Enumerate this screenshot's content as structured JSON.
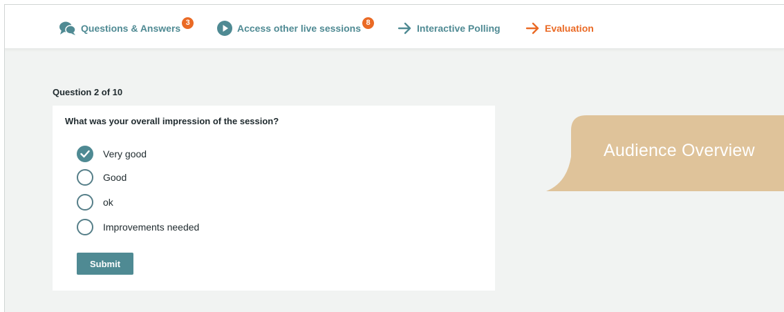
{
  "nav": {
    "items": [
      {
        "label": "Questions & Answers",
        "badge": "3",
        "icon": "chat-bubbles-icon"
      },
      {
        "label": "Access other live sessions",
        "badge": "8",
        "icon": "play-circle-icon"
      },
      {
        "label": "Interactive Polling",
        "icon": "arrow-right-icon"
      },
      {
        "label": "Evaluation",
        "icon": "arrow-right-icon",
        "active": true
      }
    ]
  },
  "poll": {
    "progress": "Question 2 of 10",
    "question": "What was your overall impression of the session?",
    "options": [
      {
        "label": "Very good",
        "selected": true
      },
      {
        "label": "Good",
        "selected": false
      },
      {
        "label": "ok",
        "selected": false
      },
      {
        "label": "Improvements needed",
        "selected": false
      }
    ],
    "submit_label": "Submit"
  },
  "overlay": {
    "label": "Audience Overview"
  },
  "colors": {
    "teal": "#4f8a93",
    "orange": "#ea6a25",
    "bubble": "#dfc39a",
    "background": "#f1f3f2"
  }
}
